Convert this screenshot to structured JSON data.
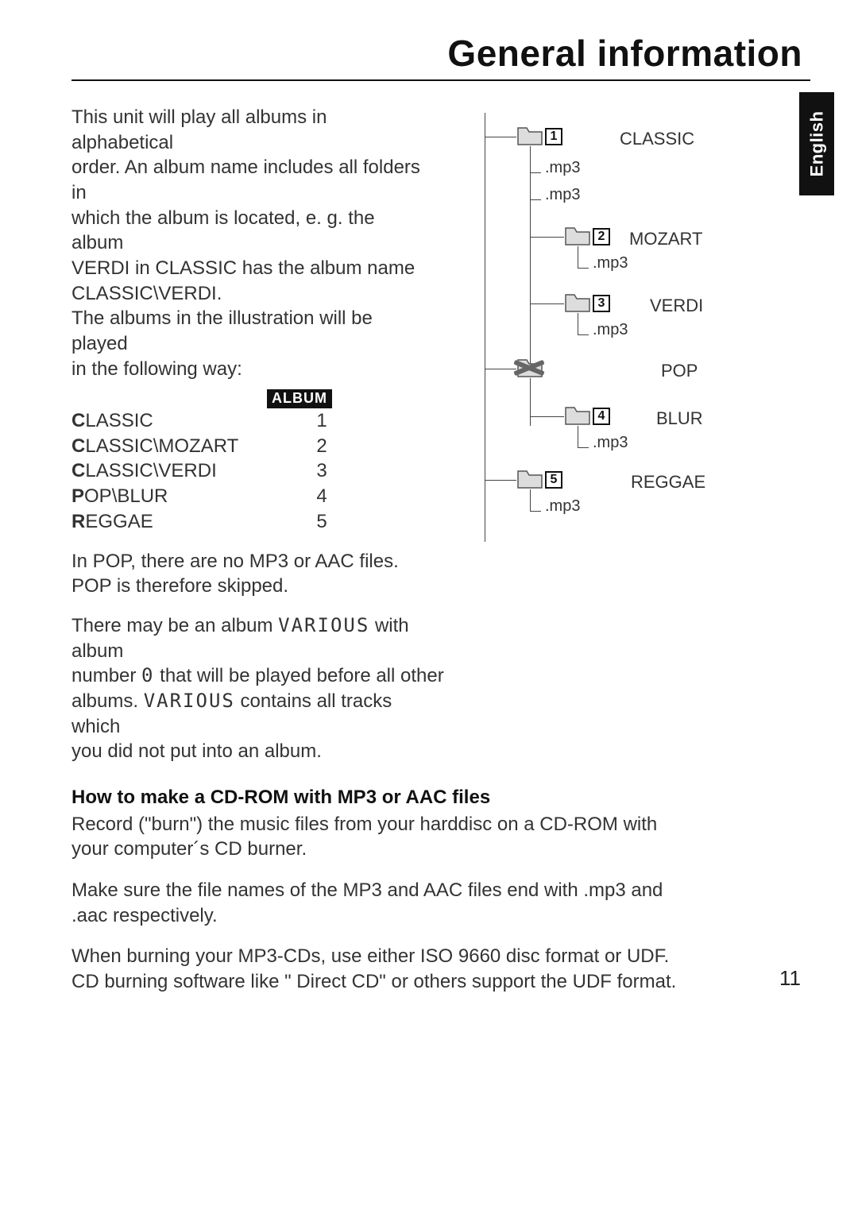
{
  "header": {
    "title": "General information"
  },
  "language_tab": "English",
  "page_number": "11",
  "left": {
    "intro_line1": "This unit will play all albums in alphabetical",
    "intro_line2": "order. An album name includes all folders in",
    "intro_line3": "which the album is located, e. g. the album",
    "intro_line4": "VERDI in CLASSIC has the album name",
    "intro_line5": "CLASSIC\\VERDI.",
    "intro_line6": "The albums in the illustration will be played",
    "intro_line7": "in the following way:",
    "album_badge": "ALBUM",
    "rows": [
      {
        "first": "C",
        "rest": "LASSIC",
        "num": "1"
      },
      {
        "first": "C",
        "rest": "LASSIC\\MOZART",
        "num": "2"
      },
      {
        "first": "C",
        "rest": "LASSIC\\VERDI",
        "num": "3"
      },
      {
        "first": "P",
        "rest": "OP\\BLUR",
        "num": "4"
      },
      {
        "first": "R",
        "rest": "EGGAE",
        "num": "5"
      }
    ],
    "pop_line1": "In POP, there are no MP3 or AAC files.",
    "pop_line2": "POP is therefore skipped.",
    "various_pre": "There may be an album ",
    "various_seg1": "VARIOUS",
    "various_mid1": " with album",
    "various_line2a": "number ",
    "various_seg2": "0",
    "various_line2b": " that will be played before all other",
    "various_line3a": "albums. ",
    "various_seg3": "VARIOUS",
    "various_line3b": " contains all tracks which",
    "various_line4": "you did not put into an album."
  },
  "tree": {
    "folders": [
      {
        "num": "1",
        "label": "CLASSIC"
      },
      {
        "num": "2",
        "label": "MOZART"
      },
      {
        "num": "3",
        "label": "VERDI"
      },
      {
        "num": "",
        "label": "POP"
      },
      {
        "num": "4",
        "label": "BLUR"
      },
      {
        "num": "5",
        "label": "REGGAE"
      }
    ],
    "mp3": ".mp3"
  },
  "section2": {
    "heading": "How to make a CD-ROM with MP3 or AAC files",
    "p1": "Record (\"burn\") the music files from your harddisc on a CD-ROM with your computer´s CD burner.",
    "p2": "Make sure the file names of the MP3 and AAC files end with .mp3 and .aac respectively.",
    "p3": "When burning your MP3-CDs, use either ISO 9660 disc format or UDF. CD burning software like \" Direct CD\" or others support the UDF format."
  }
}
